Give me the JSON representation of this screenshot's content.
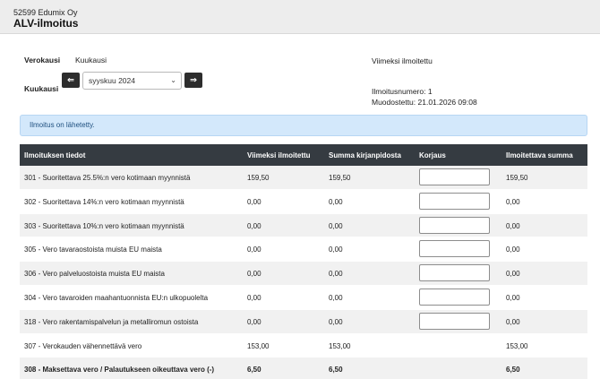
{
  "header": {
    "company": "52599 Edumix Oy",
    "title": "ALV-ilmoitus"
  },
  "form": {
    "verokausi_label": "Verokausi",
    "verokausi_value": "Kuukausi",
    "kuukausi_label": "Kuukausi",
    "prev_icon": "⇐",
    "next_icon": "⇒",
    "month_selected": "syyskuu 2024"
  },
  "info": {
    "last_reported_label": "Viimeksi ilmoitettu",
    "report_number": "Ilmoitusnumero: 1",
    "created": "Muodostettu: 21.01.2026 09:08"
  },
  "alert": {
    "text": "Ilmoitus on lähetetty."
  },
  "table": {
    "headers": [
      "Ilmoituksen tiedot",
      "Viimeksi ilmoitettu",
      "Summa kirjanpidosta",
      "Korjaus",
      "Ilmoitettava summa"
    ],
    "rows": [
      {
        "label": "301 - Suoritettava 25.5%:n vero kotimaan myynnistä",
        "last": "159,50",
        "books": "159,50",
        "final": "159,50"
      },
      {
        "label": "302 - Suoritettava 14%:n vero kotimaan myynnistä",
        "last": "0,00",
        "books": "0,00",
        "final": "0,00"
      },
      {
        "label": "303 - Suoritettava 10%:n vero kotimaan myynnistä",
        "last": "0,00",
        "books": "0,00",
        "final": "0,00"
      },
      {
        "label": "305 - Vero tavaraostoista muista EU maista",
        "last": "0,00",
        "books": "0,00",
        "final": "0,00"
      },
      {
        "label": "306 - Vero palveluostoista muista EU maista",
        "last": "0,00",
        "books": "0,00",
        "final": "0,00"
      },
      {
        "label": "304 - Vero tavaroiden maahantuonnista EU:n ulkopuolelta",
        "last": "0,00",
        "books": "0,00",
        "final": "0,00"
      },
      {
        "label": "318 - Vero rakentamispalvelun ja metalliromun ostoista",
        "last": "0,00",
        "books": "0,00",
        "final": "0,00"
      },
      {
        "label": "307 - Verokauden vähennettävä vero",
        "last": "153,00",
        "books": "153,00",
        "final": "153,00"
      },
      {
        "label": "308 - Maksettava vero / Palautukseen oikeuttava vero (-)",
        "last": "6,50",
        "books": "6,50",
        "final": "6,50"
      }
    ]
  },
  "colors": {
    "header_bg": "#353b41",
    "alert_bg": "#d3e8fb",
    "button_bg": "#2d2d2d"
  }
}
